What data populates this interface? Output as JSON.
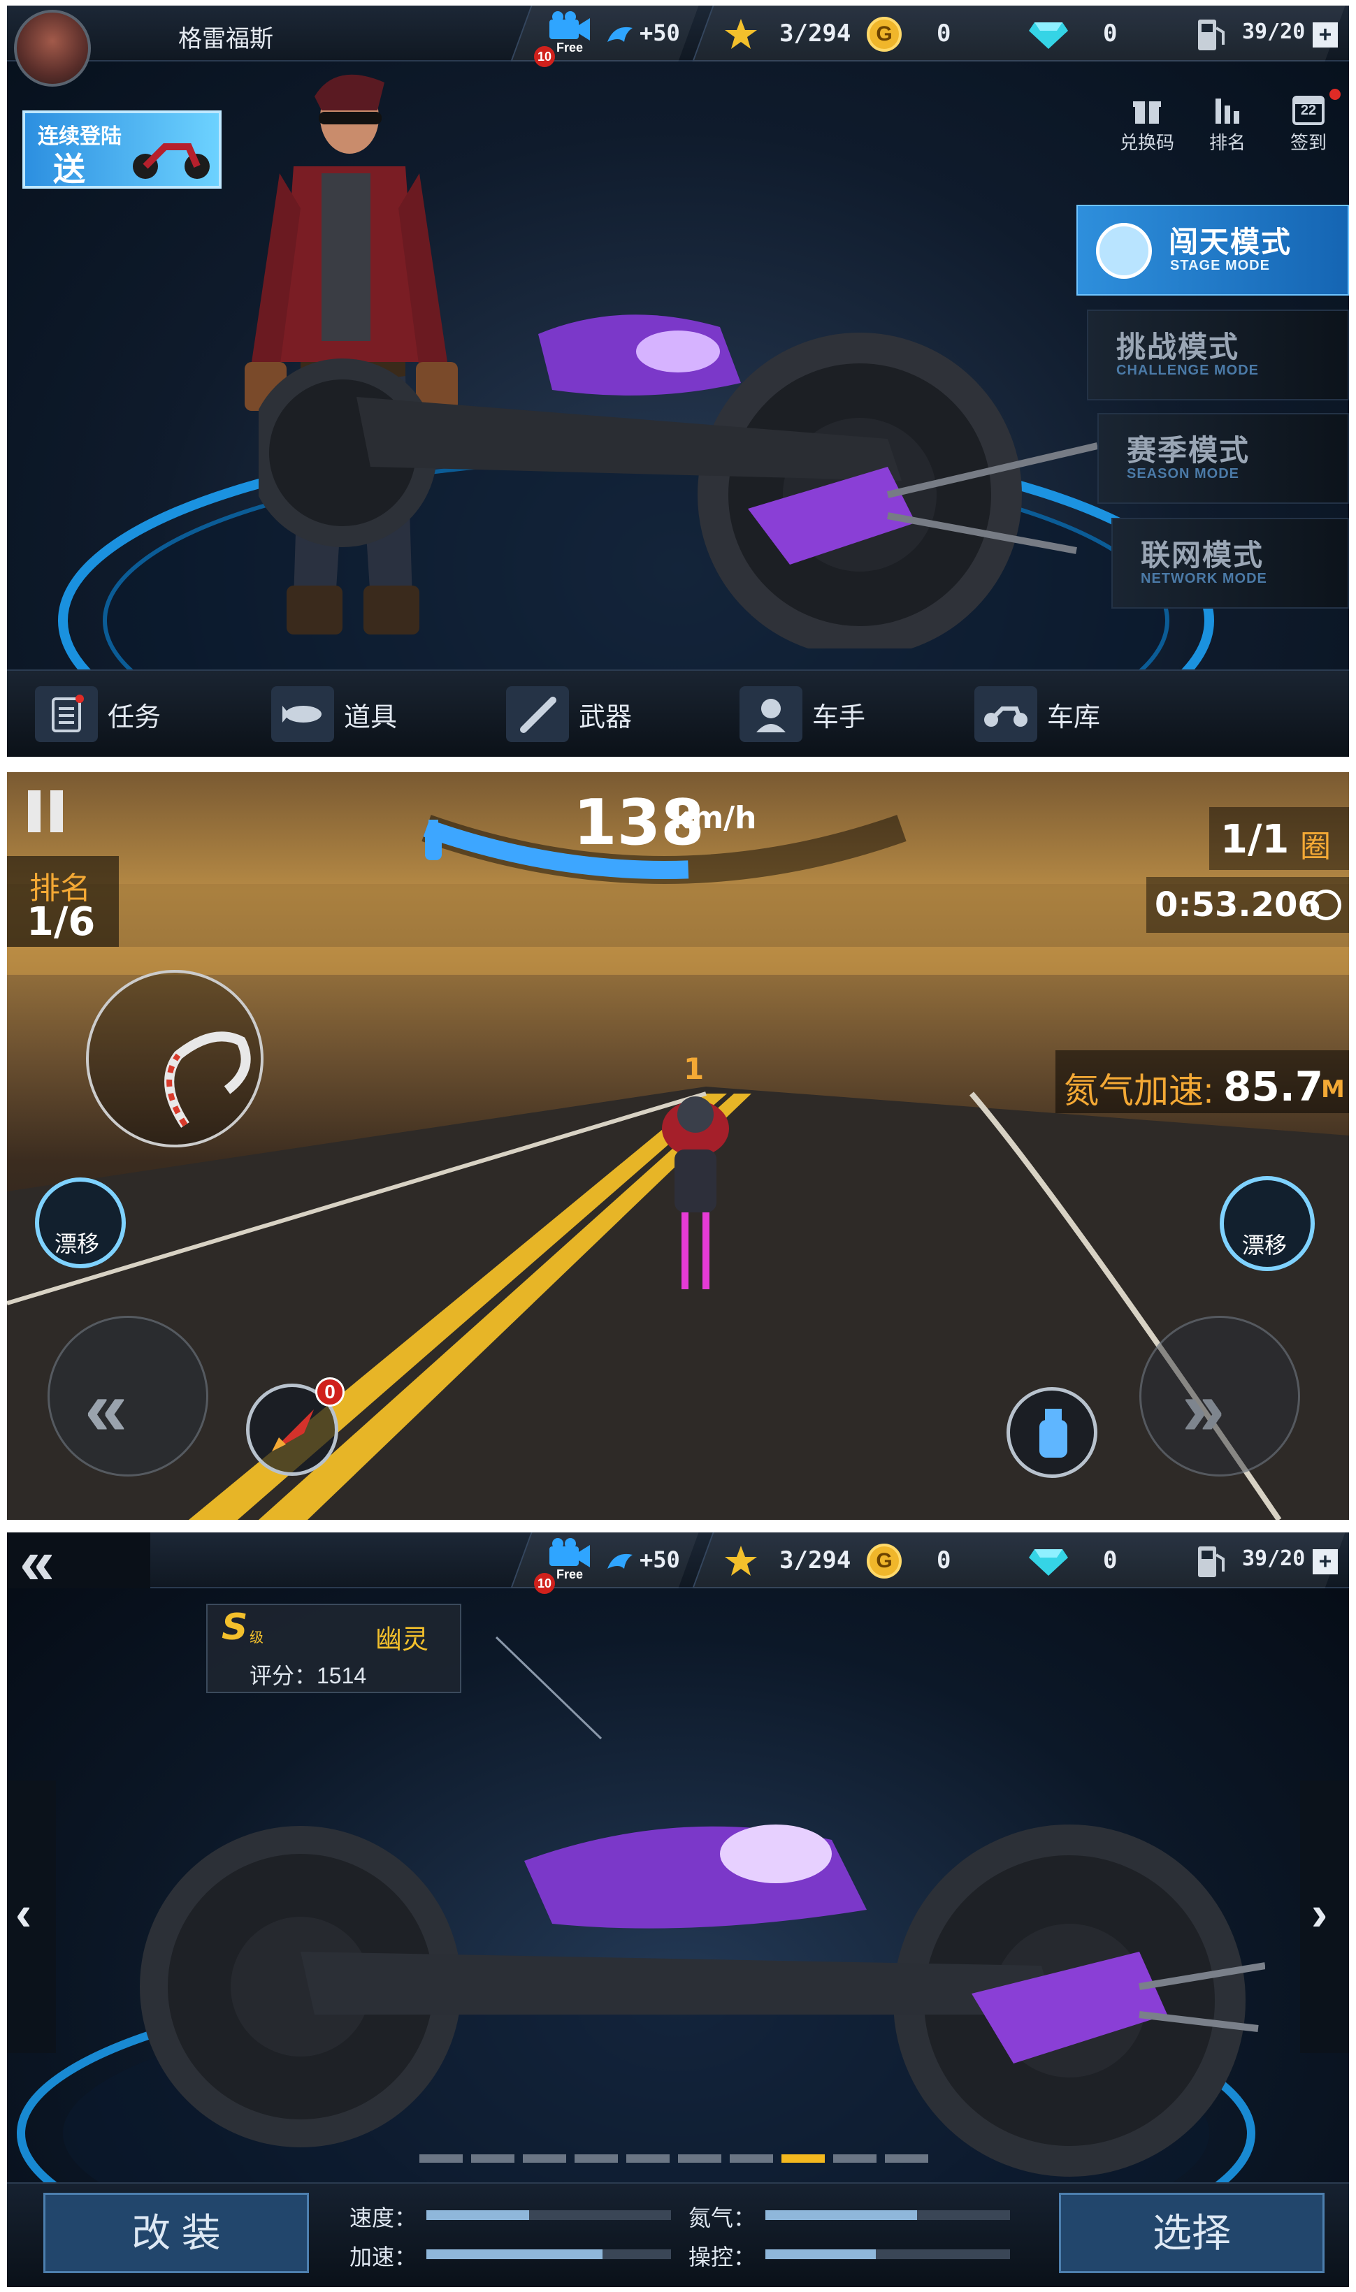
{
  "top_hud": {
    "player_name": "格雷福斯",
    "video_free": "Free",
    "video_count": "10",
    "bonus": "+50",
    "stars": "3/294",
    "gold_symbol": "G",
    "gold": "0",
    "diamonds": "0",
    "fuel": "39/20",
    "fuel_add": "+"
  },
  "screen1": {
    "login_banner_line1": "连续登陆",
    "login_banner_line2": "送",
    "quick_links": [
      {
        "label": "兑换码",
        "icon": "gift-icon"
      },
      {
        "label": "排名",
        "icon": "bar-chart-icon"
      },
      {
        "label": "签到",
        "icon": "calendar-icon",
        "day": "22"
      }
    ],
    "modes": [
      {
        "zh": "闯天模式",
        "en": "STAGE MODE"
      },
      {
        "zh": "挑战模式",
        "en": "CHALLENGE MODE"
      },
      {
        "zh": "赛季模式",
        "en": "SEASON MODE"
      },
      {
        "zh": "联网模式",
        "en": "NETWORK MODE"
      }
    ],
    "nav": [
      {
        "label": "任务",
        "icon": "task-icon"
      },
      {
        "label": "道具",
        "icon": "missile-icon"
      },
      {
        "label": "武器",
        "icon": "bat-icon"
      },
      {
        "label": "车手",
        "icon": "rider-icon"
      },
      {
        "label": "车库",
        "icon": "motorbike-icon"
      }
    ]
  },
  "screen2": {
    "speed": "138",
    "speed_unit": "km/h",
    "speed_fill": 0.55,
    "rank_label": "排名",
    "rank_value": "1/6",
    "lap_value": "1/1",
    "lap_label": "圈",
    "timer": "0:53.206",
    "nitro_label": "氮气加速:",
    "nitro_value": "85.7",
    "nitro_unit": "M",
    "opponent_marker": "1",
    "drift_left": "漂移",
    "drift_right": "漂移",
    "rocket_count": "0"
  },
  "screen3": {
    "grade": "S",
    "grade_suffix": "级",
    "bike_name": "幽灵",
    "score_label": "评分：1514",
    "page_count": 10,
    "page_active": 8,
    "modify_label": "改 装",
    "select_label": "选择",
    "stats": [
      {
        "label": "速度：",
        "value": 0.42
      },
      {
        "label": "氮气：",
        "value": 0.62
      },
      {
        "label": "加速：",
        "value": 0.72
      },
      {
        "label": "操控：",
        "value": 0.45
      }
    ]
  }
}
